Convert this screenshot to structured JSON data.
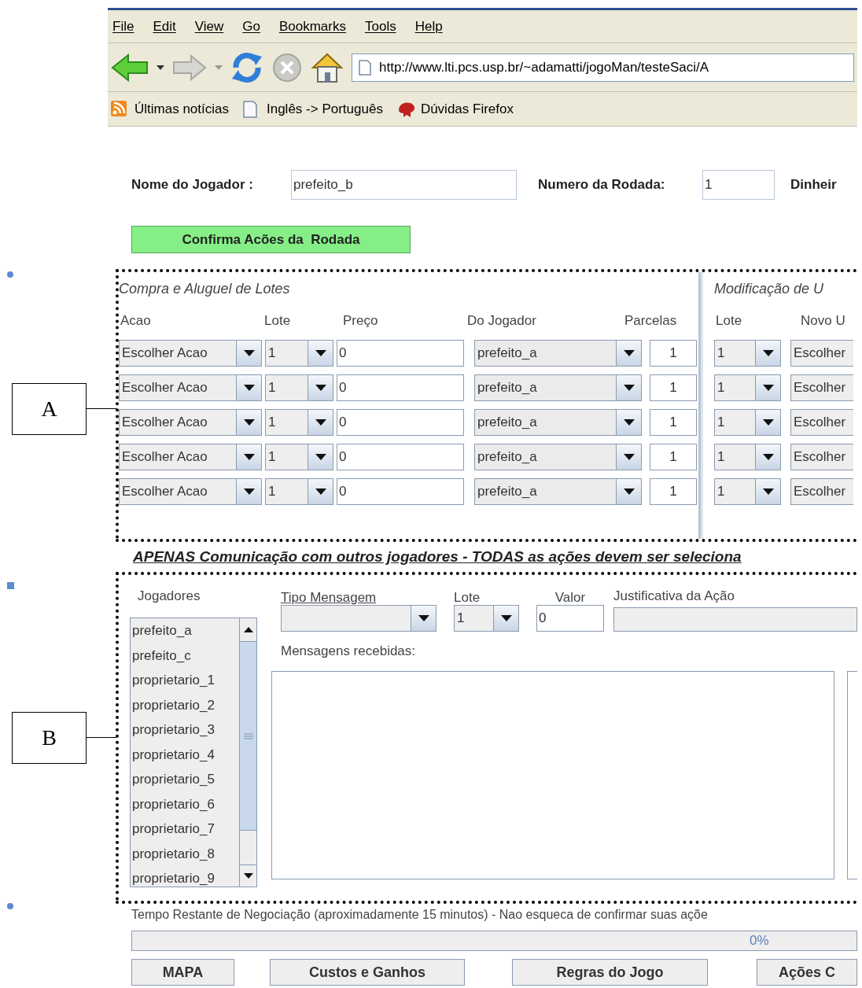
{
  "browser": {
    "menu": [
      "File",
      "Edit",
      "View",
      "Go",
      "Bookmarks",
      "Tools",
      "Help"
    ],
    "address": "http://www.lti.pcs.usp.br/~adamatti/jogoMan/testeSaci/A",
    "bookmarks": [
      "Últimas notícias",
      "Inglês -> Português",
      "Dúvidas Firefox"
    ]
  },
  "player": {
    "name_label": "Nome do Jogador :",
    "name_value": "prefeito_b",
    "round_label": "Numero da Rodada:",
    "round_value": "1",
    "money_label": "Dinheir"
  },
  "confirm_button": "Confirma Acões da  Rodada",
  "lots": {
    "title": "Compra e Aluguel de Lotes",
    "columns": [
      "Acao",
      "Lote",
      "Preço",
      "Do Jogador",
      "Parcelas"
    ],
    "rows": [
      {
        "action": "Escolher Acao",
        "lot": "1",
        "price": "0",
        "player": "prefeito_a",
        "installments": "1"
      },
      {
        "action": "Escolher Acao",
        "lot": "1",
        "price": "0",
        "player": "prefeito_a",
        "installments": "1"
      },
      {
        "action": "Escolher Acao",
        "lot": "1",
        "price": "0",
        "player": "prefeito_a",
        "installments": "1"
      },
      {
        "action": "Escolher Acao",
        "lot": "1",
        "price": "0",
        "player": "prefeito_a",
        "installments": "1"
      },
      {
        "action": "Escolher Acao",
        "lot": "1",
        "price": "0",
        "player": "prefeito_a",
        "installments": "1"
      }
    ]
  },
  "usage": {
    "title": "Modificação de U",
    "columns": [
      "Lote",
      "Novo U"
    ],
    "rows": [
      {
        "lot": "1",
        "new_use": "Escolher"
      },
      {
        "lot": "1",
        "new_use": "Escolher"
      },
      {
        "lot": "1",
        "new_use": "Escolher"
      },
      {
        "lot": "1",
        "new_use": "Escolher"
      },
      {
        "lot": "1",
        "new_use": "Escolher"
      }
    ]
  },
  "communication": {
    "heading": "APENAS Comunicação com outros jogadores - TODAS as ações devem ser seleciona",
    "players_label": "Jogadores",
    "players": [
      "prefeito_a",
      "prefeito_c",
      "proprietario_1",
      "proprietario_2",
      "proprietario_3",
      "proprietario_4",
      "proprietario_5",
      "proprietario_6",
      "proprietario_7",
      "proprietario_8",
      "proprietario_9"
    ],
    "message_type_label": "Tipo Mensagem",
    "lot_label": "Lote",
    "lot_value": "1",
    "value_label": "Valor",
    "value": "0",
    "justification_label": "Justificativa da Ação",
    "received_label": "Mensagens recebidas:"
  },
  "footer": {
    "time_text": "Tempo Restante de Negociação (aproximadamente 15 minutos) - Nao esqueca de confirmar suas açõe",
    "progress": {
      "level": 0,
      "reading": "0%"
    },
    "buttons": [
      "MAPA",
      "Custos e Ganhos",
      "Regras do Jogo",
      "Ações C"
    ]
  },
  "annotations": [
    {
      "label": "A"
    },
    {
      "label": "B"
    }
  ]
}
